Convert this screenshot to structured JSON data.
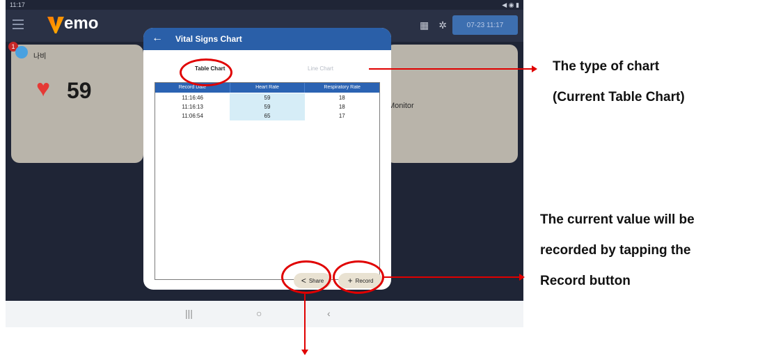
{
  "statusbar": {
    "time": "11:17",
    "indicators": "◀ ◉ ▮"
  },
  "app": {
    "logo_text": "emo",
    "datetime": "07-23 11:17",
    "colors": {
      "header": "#2a5fa8",
      "annotation": "#e00000",
      "accent": "#ff7a00"
    }
  },
  "patient": {
    "badge": "1",
    "name": "나비",
    "heart_rate": "59",
    "monitor_label": "Monitor"
  },
  "dialog": {
    "title": "Vital Signs Chart",
    "tabs": {
      "table": "Table Chart",
      "line": "Line Chart"
    },
    "table": {
      "headers": [
        "Record Date",
        "Heart Rate",
        "Respiratory Rate"
      ],
      "rows": [
        [
          "11:16:46",
          "59",
          "18"
        ],
        [
          "11:16:13",
          "59",
          "18"
        ],
        [
          "11:06:54",
          "65",
          "17"
        ]
      ]
    },
    "buttons": {
      "share": "Share",
      "record": "Record"
    }
  },
  "annotations": {
    "chart_type_line1": "The type of chart",
    "chart_type_line2": "(Current Table Chart)",
    "record_line1": "The current value will be",
    "record_line2": "recorded by tapping the",
    "record_line3": "Record button"
  }
}
